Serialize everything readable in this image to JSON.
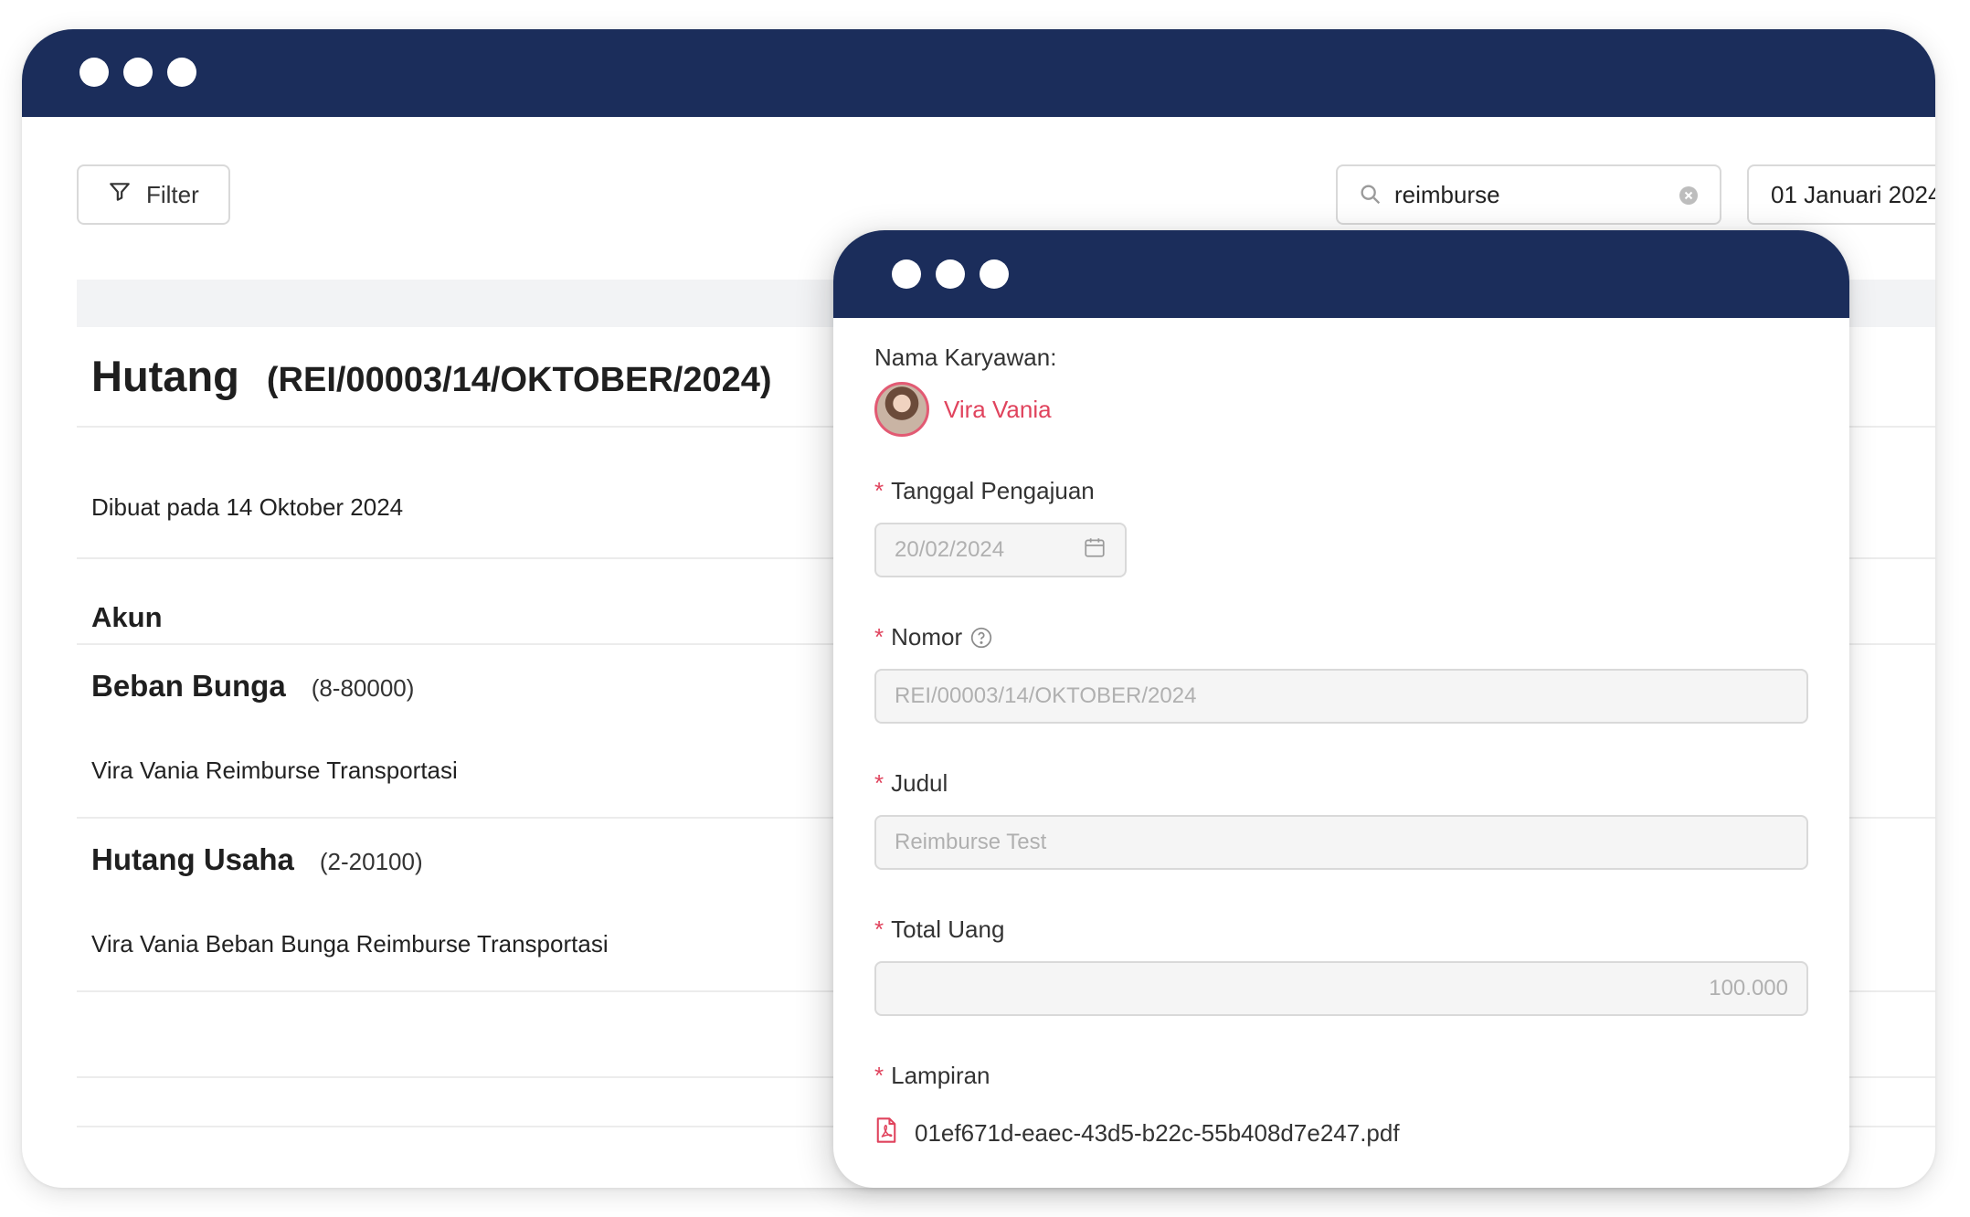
{
  "colors": {
    "titlebar": "#1b2d5b",
    "accent": "#e0435d"
  },
  "back_window": {
    "filter_label": "Filter",
    "search": {
      "value": "reimburse"
    },
    "date_filter": "01 Januari 2024",
    "title": "Hutang",
    "title_number": "(REI/00003/14/OKTOBER/2024)",
    "created_text": "Dibuat pada 14 Oktober 2024",
    "section_label": "Akun",
    "accounts": [
      {
        "name": "Beban Bunga",
        "code": "(8-80000)",
        "description": "Vira Vania Reimburse Transportasi"
      },
      {
        "name": "Hutang Usaha",
        "code": "(2-20100)",
        "description": "Vira Vania Beban Bunga Reimburse Transportasi"
      }
    ]
  },
  "form": {
    "employee_label": "Nama Karyawan:",
    "employee_name": "Vira Vania",
    "required_mark": "*",
    "date_label": "Tanggal Pengajuan",
    "date_value": "20/02/2024",
    "number_label": "Nomor",
    "number_value": "REI/00003/14/OKTOBER/2024",
    "title_label": "Judul",
    "title_value": "Reimburse Test",
    "amount_label": "Total Uang",
    "amount_value": "100.000",
    "attachment_label": "Lampiran",
    "attachment_file": "01ef671d-eaec-43d5-b22c-55b408d7e247.pdf"
  }
}
